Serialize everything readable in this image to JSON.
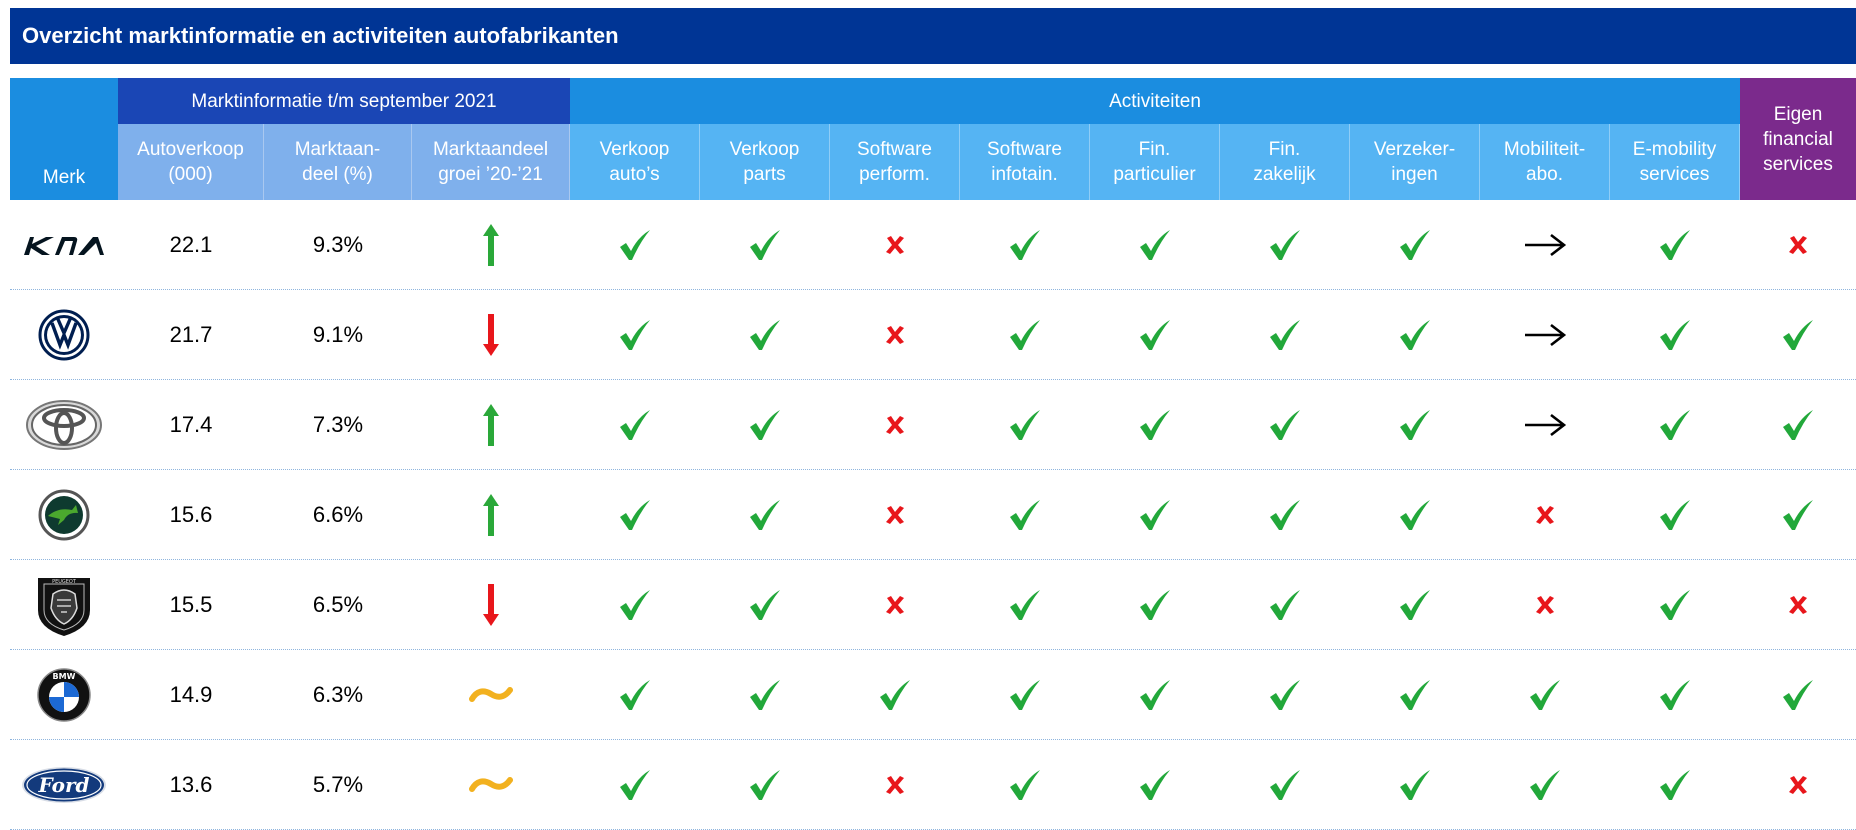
{
  "title": "Overzicht marktinformatie en activiteiten autofabrikanten",
  "header": {
    "merk": "Merk",
    "market_group": "Marktinformatie t/m september 2021",
    "activities_group": "Activiteiten",
    "eigen": "Eigen\nfinancial\nservices",
    "market_columns": [
      "Autoverkoop\n(000)",
      "Marktaan-\ndeel (%)",
      "Marktaandeel\ngroei ’20-’21"
    ],
    "activity_columns": [
      "Verkoop\nauto’s",
      "Verkoop\nparts",
      "Software\nperform.",
      "Software\ninfotain.",
      "Fin.\nparticulier",
      "Fin.\nzakelijk",
      "Verzeker-\ningen",
      "Mobiliteit-\nabo.",
      "E-mobility\nservices"
    ]
  },
  "colors": {
    "title_bg": "#003595",
    "market_group_bg": "#1a46b5",
    "activities_bg": "#1b8de0",
    "market_sub_bg": "#7fb0ec",
    "activities_sub_bg": "#55b4f3",
    "eigen_bg": "#7b2a8c",
    "check": "#22a83a",
    "cross": "#e8161b",
    "arrow_up": "#2aa839",
    "arrow_down": "#e8161b",
    "tilde": "#f2b11f"
  },
  "rows": [
    {
      "brand": "kia-logo",
      "sales": "22.1",
      "share": "9.3%",
      "growth": "up",
      "activities": [
        "check",
        "check",
        "cross",
        "check",
        "check",
        "check",
        "check",
        "arrow",
        "check"
      ],
      "eigen": "cross"
    },
    {
      "brand": "volkswagen-logo",
      "sales": "21.7",
      "share": "9.1%",
      "growth": "down",
      "activities": [
        "check",
        "check",
        "cross",
        "check",
        "check",
        "check",
        "check",
        "arrow",
        "check"
      ],
      "eigen": "check"
    },
    {
      "brand": "toyota-logo",
      "sales": "17.4",
      "share": "7.3%",
      "growth": "up",
      "activities": [
        "check",
        "check",
        "cross",
        "check",
        "check",
        "check",
        "check",
        "arrow",
        "check"
      ],
      "eigen": "check"
    },
    {
      "brand": "skoda-logo",
      "sales": "15.6",
      "share": "6.6%",
      "growth": "up",
      "activities": [
        "check",
        "check",
        "cross",
        "check",
        "check",
        "check",
        "check",
        "cross",
        "check"
      ],
      "eigen": "check"
    },
    {
      "brand": "peugeot-logo",
      "sales": "15.5",
      "share": "6.5%",
      "growth": "down",
      "activities": [
        "check",
        "check",
        "cross",
        "check",
        "check",
        "check",
        "check",
        "cross",
        "check"
      ],
      "eigen": "cross"
    },
    {
      "brand": "bmw-logo",
      "sales": "14.9",
      "share": "6.3%",
      "growth": "flat",
      "activities": [
        "check",
        "check",
        "check",
        "check",
        "check",
        "check",
        "check",
        "check",
        "check"
      ],
      "eigen": "check"
    },
    {
      "brand": "ford-logo",
      "sales": "13.6",
      "share": "5.7%",
      "growth": "flat",
      "activities": [
        "check",
        "check",
        "cross",
        "check",
        "check",
        "check",
        "check",
        "check",
        "check"
      ],
      "eigen": "cross"
    }
  ]
}
